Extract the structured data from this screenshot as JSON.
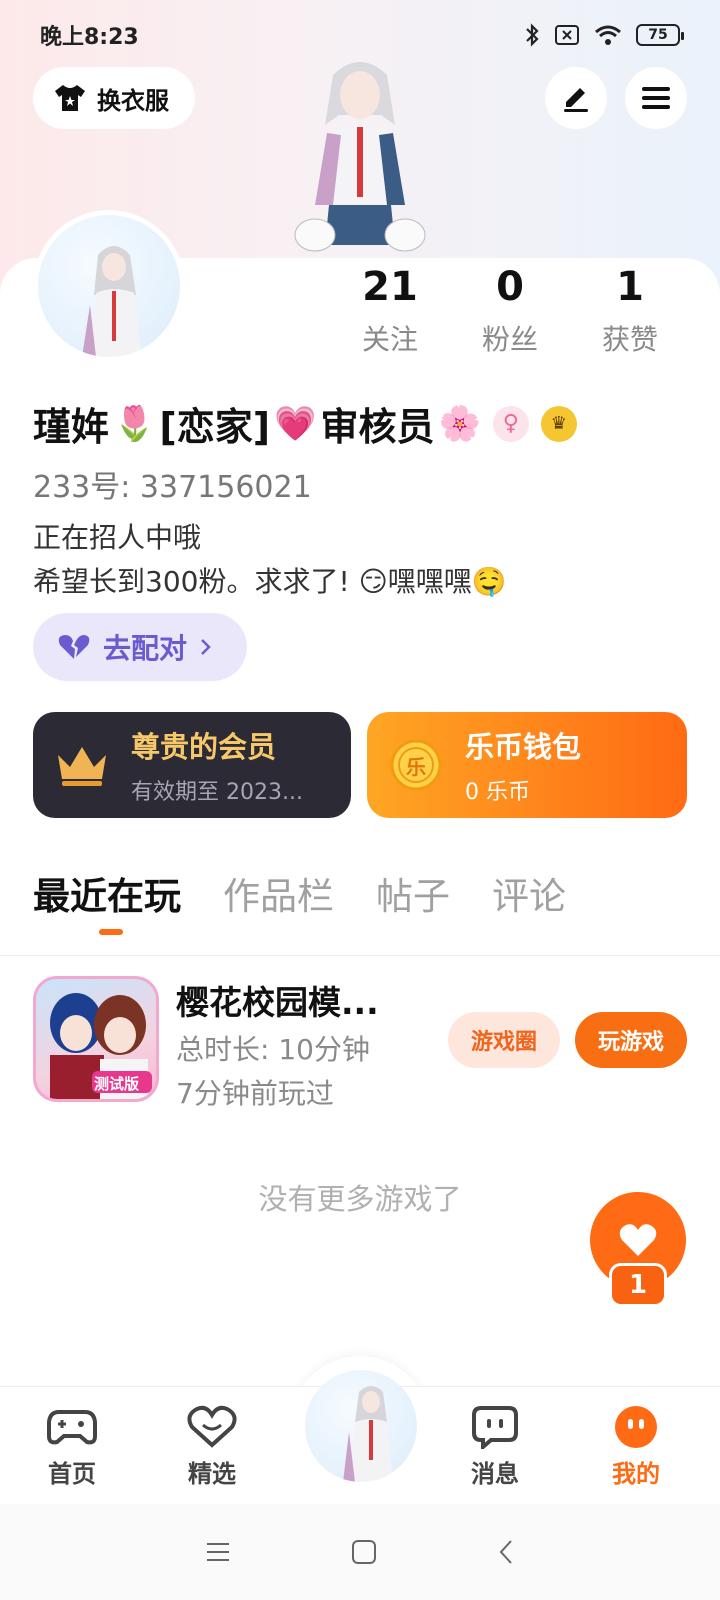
{
  "status_bar": {
    "time": "晚上8:23",
    "battery": "75"
  },
  "header": {
    "outfit_label": "换衣服"
  },
  "stats": [
    {
      "value": "21",
      "label": "关注"
    },
    {
      "value": "0",
      "label": "粉丝"
    },
    {
      "value": "1",
      "label": "获赞"
    }
  ],
  "profile": {
    "name_part1": "瑾姩",
    "name_part2": "[恋家]",
    "name_part3": "审核员",
    "uid": "233号: 337156021",
    "bio_line1": "正在招人中哦",
    "bio_line2": "希望长到300粉。求求了! ",
    "bio_line2_end": "嘿嘿嘿"
  },
  "match": {
    "label": "去配对"
  },
  "vip_card": {
    "title": "尊贵的会员",
    "subtitle": "有效期至 2023..."
  },
  "coin_card": {
    "title": "乐币钱包",
    "subtitle": "0 乐币",
    "coin_glyph": "乐"
  },
  "tabs": [
    "最近在玩",
    "作品栏",
    "帖子",
    "评论"
  ],
  "game": {
    "name": "樱花校园模...",
    "duration": "总时长: 10分钟",
    "last_played": "7分钟前玩过",
    "circle_label": "游戏圈",
    "play_label": "玩游戏",
    "icon_tag": "测试版"
  },
  "empty_text": "没有更多游戏了",
  "like": {
    "count": "1"
  },
  "bottom_nav": [
    {
      "label": "首页"
    },
    {
      "label": "精选"
    },
    {
      "label": "消息"
    },
    {
      "label": "我的"
    }
  ],
  "colors": {
    "accent": "#ff6a14",
    "vip_bg": "#2c2a35",
    "vip_gold": "#f6c86a",
    "match_purple": "#6b5bd0"
  }
}
